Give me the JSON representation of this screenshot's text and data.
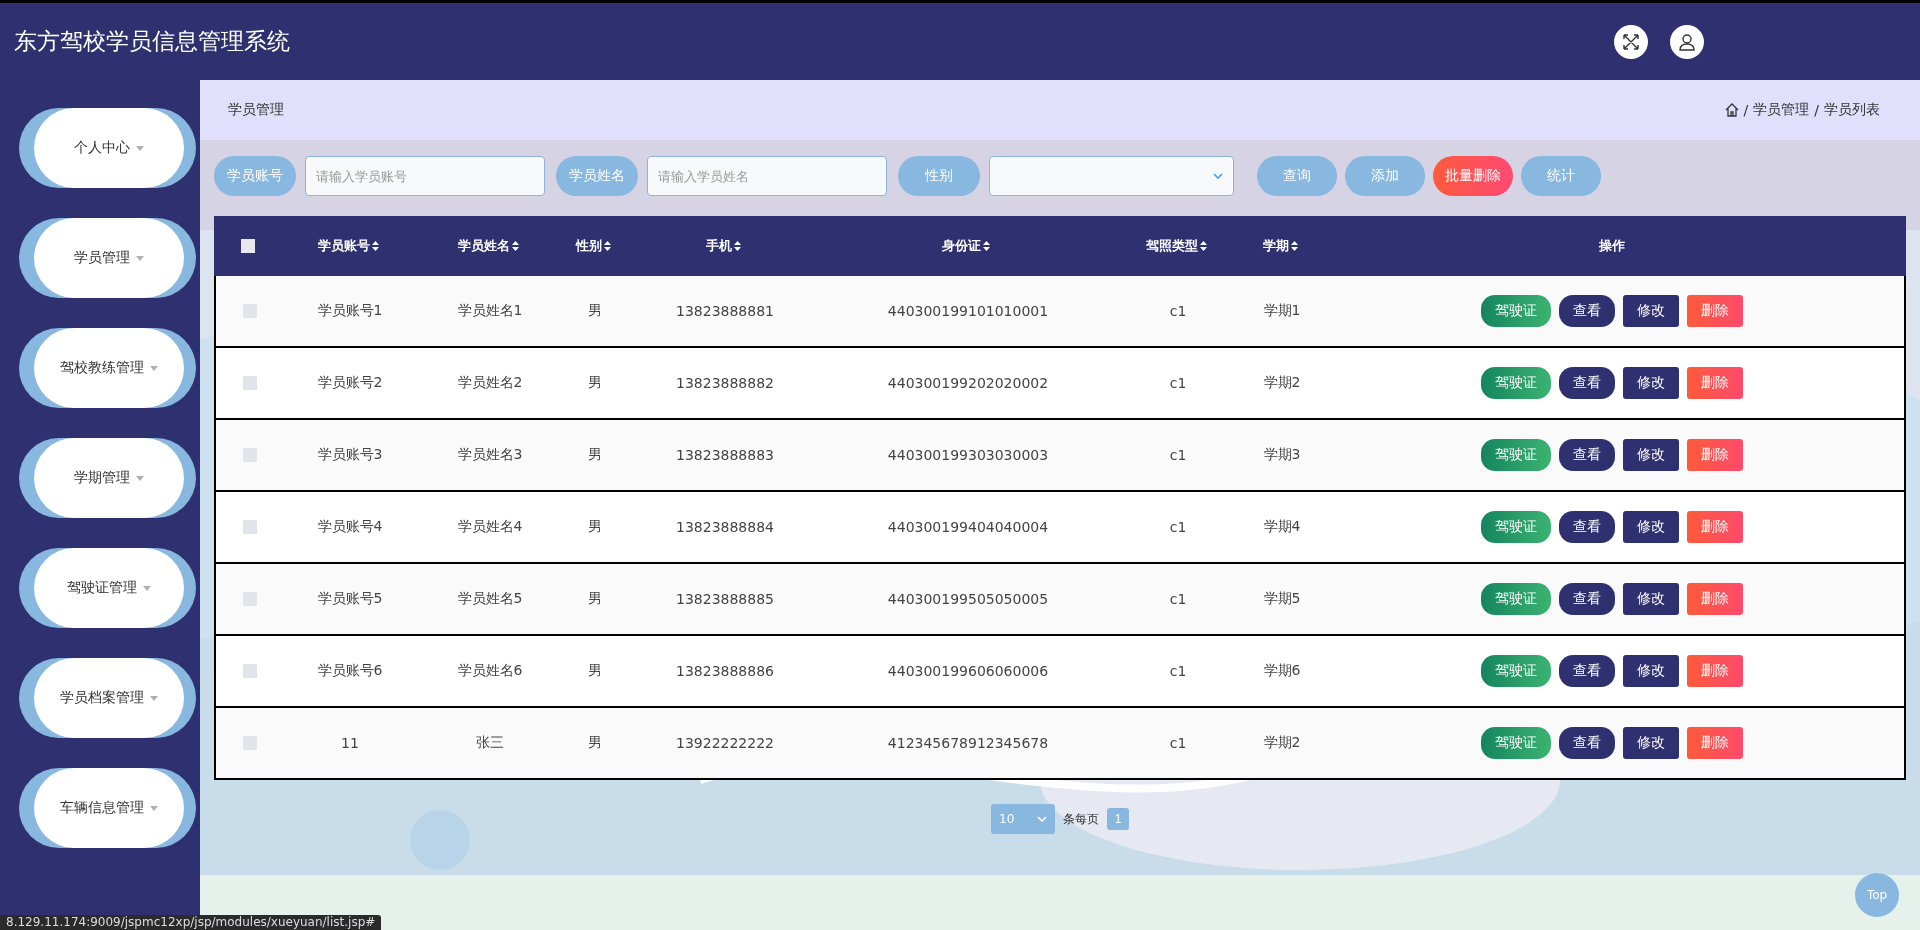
{
  "header": {
    "title": "东方驾校学员信息管理系统"
  },
  "sidebar": {
    "items": [
      {
        "label": "个人中心"
      },
      {
        "label": "学员管理"
      },
      {
        "label": "驾校教练管理"
      },
      {
        "label": "学期管理"
      },
      {
        "label": "驾驶证管理"
      },
      {
        "label": "学员档案管理"
      },
      {
        "label": "车辆信息管理"
      }
    ]
  },
  "page_header": {
    "title": "学员管理",
    "breadcrumb": [
      {
        "separator": "/",
        "label": "学员管理"
      },
      {
        "separator": "/",
        "label": "学员列表"
      }
    ]
  },
  "filters": [
    {
      "kind": "input",
      "label": "学员账号",
      "placeholder": "请输入学员账号"
    },
    {
      "kind": "input",
      "label": "学员姓名",
      "placeholder": "请输入学员姓名"
    },
    {
      "kind": "select",
      "label": "性别"
    }
  ],
  "toolbar_buttons": [
    {
      "label": "查询",
      "kind": "primary"
    },
    {
      "label": "添加",
      "kind": "primary"
    },
    {
      "label": "批量删除",
      "kind": "danger"
    },
    {
      "label": "统计",
      "kind": "primary"
    }
  ],
  "table": {
    "select_all_checked": false,
    "columns": [
      {
        "label": "学员账号",
        "sortable": true
      },
      {
        "label": "学员姓名",
        "sortable": true
      },
      {
        "label": "性别",
        "sortable": true
      },
      {
        "label": "手机",
        "sortable": true
      },
      {
        "label": "身份证",
        "sortable": true
      },
      {
        "label": "驾照类型",
        "sortable": true
      },
      {
        "label": "学期",
        "sortable": true
      },
      {
        "label": "操作",
        "sortable": false
      }
    ],
    "rows": [
      {
        "checked": false,
        "cells": [
          "学员账号1",
          "学员姓名1",
          "男",
          "13823888881",
          "440300199101010001",
          "c1",
          "学期1"
        ],
        "actions": [
          {
            "label": "驾驶证",
            "kind": "license"
          },
          {
            "label": "查看",
            "kind": "view"
          },
          {
            "label": "修改",
            "kind": "edit"
          },
          {
            "label": "删除",
            "kind": "delete"
          }
        ]
      },
      {
        "checked": false,
        "cells": [
          "学员账号2",
          "学员姓名2",
          "男",
          "13823888882",
          "440300199202020002",
          "c1",
          "学期2"
        ],
        "actions": [
          {
            "label": "驾驶证",
            "kind": "license"
          },
          {
            "label": "查看",
            "kind": "view"
          },
          {
            "label": "修改",
            "kind": "edit"
          },
          {
            "label": "删除",
            "kind": "delete"
          }
        ]
      },
      {
        "checked": false,
        "cells": [
          "学员账号3",
          "学员姓名3",
          "男",
          "13823888883",
          "440300199303030003",
          "c1",
          "学期3"
        ],
        "actions": [
          {
            "label": "驾驶证",
            "kind": "license"
          },
          {
            "label": "查看",
            "kind": "view"
          },
          {
            "label": "修改",
            "kind": "edit"
          },
          {
            "label": "删除",
            "kind": "delete"
          }
        ]
      },
      {
        "checked": false,
        "cells": [
          "学员账号4",
          "学员姓名4",
          "男",
          "13823888884",
          "440300199404040004",
          "c1",
          "学期4"
        ],
        "actions": [
          {
            "label": "驾驶证",
            "kind": "license"
          },
          {
            "label": "查看",
            "kind": "view"
          },
          {
            "label": "修改",
            "kind": "edit"
          },
          {
            "label": "删除",
            "kind": "delete"
          }
        ]
      },
      {
        "checked": false,
        "cells": [
          "学员账号5",
          "学员姓名5",
          "男",
          "13823888885",
          "440300199505050005",
          "c1",
          "学期5"
        ],
        "actions": [
          {
            "label": "驾驶证",
            "kind": "license"
          },
          {
            "label": "查看",
            "kind": "view"
          },
          {
            "label": "修改",
            "kind": "edit"
          },
          {
            "label": "删除",
            "kind": "delete"
          }
        ]
      },
      {
        "checked": false,
        "cells": [
          "学员账号6",
          "学员姓名6",
          "男",
          "13823888886",
          "440300199606060006",
          "c1",
          "学期6"
        ],
        "actions": [
          {
            "label": "驾驶证",
            "kind": "license"
          },
          {
            "label": "查看",
            "kind": "view"
          },
          {
            "label": "修改",
            "kind": "edit"
          },
          {
            "label": "删除",
            "kind": "delete"
          }
        ]
      },
      {
        "checked": false,
        "cells": [
          "11",
          "张三",
          "男",
          "13922222222",
          "412345678912345678",
          "c1",
          "学期2"
        ],
        "actions": [
          {
            "label": "驾驶证",
            "kind": "license"
          },
          {
            "label": "查看",
            "kind": "view"
          },
          {
            "label": "修改",
            "kind": "edit"
          },
          {
            "label": "删除",
            "kind": "delete"
          }
        ]
      }
    ]
  },
  "pagination": {
    "page_size": "10",
    "page_size_label": "条每页",
    "pages": [
      {
        "label": "1",
        "selected": true
      }
    ]
  },
  "back_to_top": "Top",
  "status_url": "8.129.11.174:9009/jspmc12xp/jsp/modules/xueyuan/list.jsp#"
}
